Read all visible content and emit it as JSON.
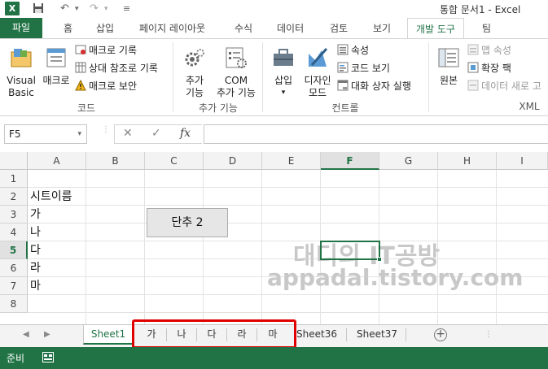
{
  "window": {
    "title": "통합 문서1 - Excel",
    "app_icon": "excel-icon"
  },
  "quick_access": {
    "save_icon": "save-icon",
    "undo_icon": "undo-icon",
    "redo_icon": "redo-icon",
    "customize_icon": "customize-icon"
  },
  "tabs": {
    "file": "파일",
    "home": "홈",
    "insert": "삽입",
    "page_layout": "페이지 레이아웃",
    "formulas": "수식",
    "data": "데이터",
    "review": "검토",
    "view": "보기",
    "developer": "개발 도구",
    "team": "팀"
  },
  "ribbon": {
    "code": {
      "label": "코드",
      "visual_basic": [
        "Visual",
        "Basic"
      ],
      "macro": "매크로",
      "record_macro": "매크로 기록",
      "relative_ref": "상대 참조로 기록",
      "macro_security": "매크로 보안"
    },
    "addins": {
      "label": "추가 기능",
      "addins": [
        "추가",
        "기능"
      ],
      "com_addins": [
        "COM",
        "추가 기능"
      ]
    },
    "controls": {
      "label": "컨트롤",
      "insert": "삽입",
      "design_mode": [
        "디자인",
        "모드"
      ],
      "properties": "속성",
      "view_code": "코드 보기",
      "run_dialog": "대화 상자 실행"
    },
    "xml": {
      "label": "XML",
      "source": "원본",
      "map_props": "맵 속성",
      "expansion_packs": "확장 팩",
      "refresh_data": "데이터 새로 고"
    }
  },
  "formula_bar": {
    "name_box": "F5",
    "cancel": "✕",
    "enter": "✓",
    "fx": "fx",
    "value": ""
  },
  "grid": {
    "columns": [
      "A",
      "B",
      "C",
      "D",
      "E",
      "F",
      "G",
      "H",
      "I"
    ],
    "selected_column": "F",
    "rows": [
      "1",
      "2",
      "3",
      "4",
      "5",
      "6",
      "7",
      "8"
    ],
    "selected_row": "5",
    "cells": {
      "A2": "시트이름",
      "A3": "가",
      "A4": "나",
      "A5": "다",
      "A6": "라",
      "A7": "마"
    },
    "selected_cell": "F5",
    "form_button": "단추 2",
    "watermark": {
      "line1": "대디의 IT공방",
      "line2": "appadal.tistory.com"
    }
  },
  "sheet_tabs": {
    "tabs": [
      "Sheet1",
      "가",
      "나",
      "다",
      "라",
      "마",
      "Sheet36",
      "Sheet37"
    ],
    "active": "Sheet1",
    "add_sheet": "+"
  },
  "status_bar": {
    "ready": "준비"
  }
}
